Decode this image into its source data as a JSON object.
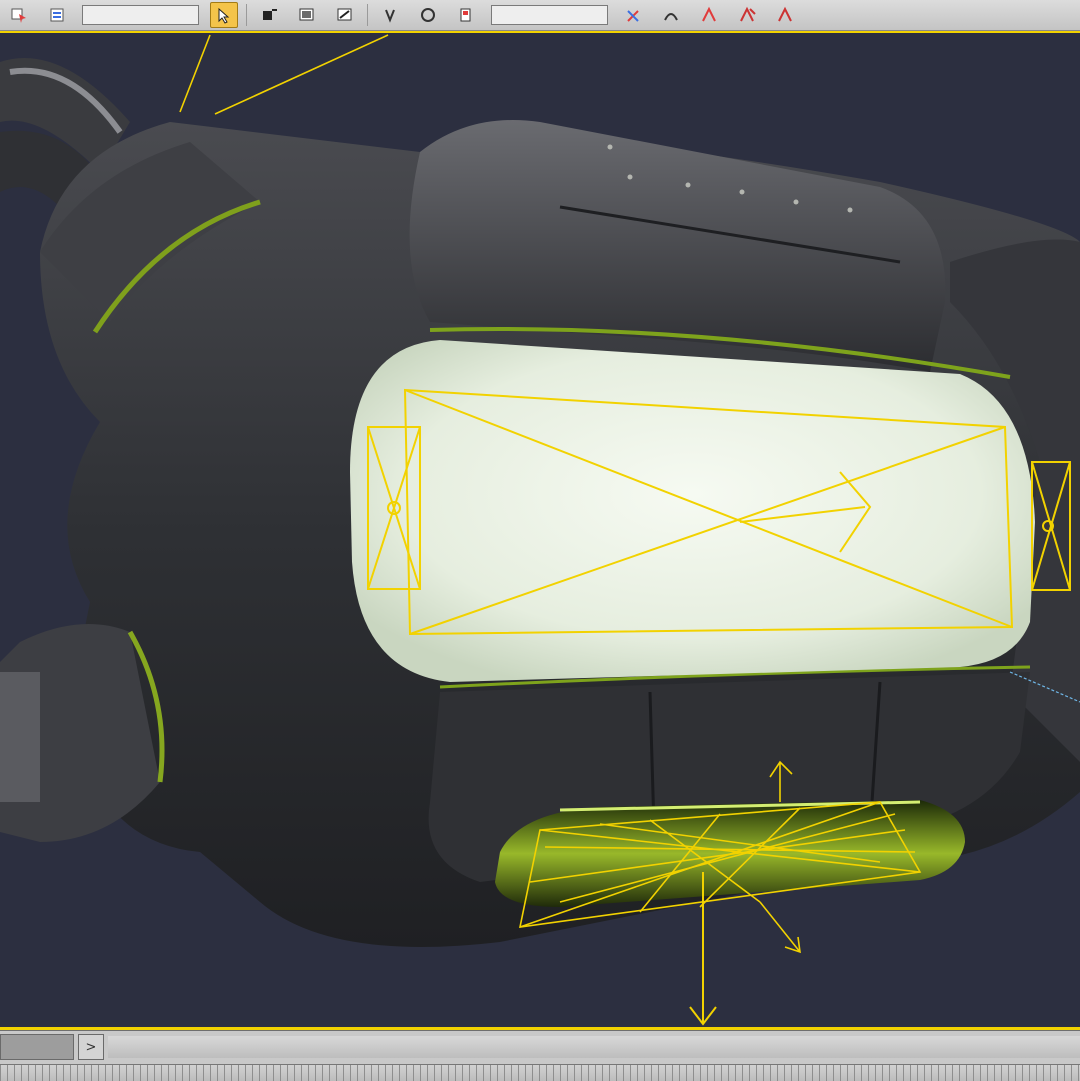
{
  "toolbar": {
    "tools": [
      {
        "name": "select-object-tool",
        "icon": "select-icon"
      },
      {
        "name": "select-by-name-tool",
        "icon": "list-icon"
      },
      {
        "name": "selection-region-tool",
        "icon": "region-icon"
      },
      {
        "name": "select-and-move-tool",
        "icon": "move-icon",
        "active": true
      },
      {
        "name": "select-and-rotate-tool",
        "icon": "rotate-icon"
      },
      {
        "name": "select-and-scale-tool",
        "icon": "scale-icon"
      },
      {
        "name": "reference-coordinate-tool",
        "icon": "coordinate-icon"
      },
      {
        "name": "snap-toggle-tool",
        "icon": "magnet-icon"
      },
      {
        "name": "angle-snap-tool",
        "icon": "angle-snap-icon"
      },
      {
        "name": "mirror-tool",
        "icon": "mirror-icon"
      },
      {
        "name": "align-tool",
        "icon": "align-icon"
      },
      {
        "name": "curve-editor-tool",
        "icon": "curve-icon"
      },
      {
        "name": "render-setup-tool",
        "icon": "teapot-icon"
      },
      {
        "name": "render-tool",
        "icon": "render-icon"
      }
    ],
    "selection_set_value": "",
    "named_set_value": ""
  },
  "viewport": {
    "background_color": "#2c2f40",
    "selection_color": "#f2d200",
    "glow_color": "#e9f2e4"
  },
  "timeline": {
    "frame_value": "",
    "next_label": ">"
  }
}
